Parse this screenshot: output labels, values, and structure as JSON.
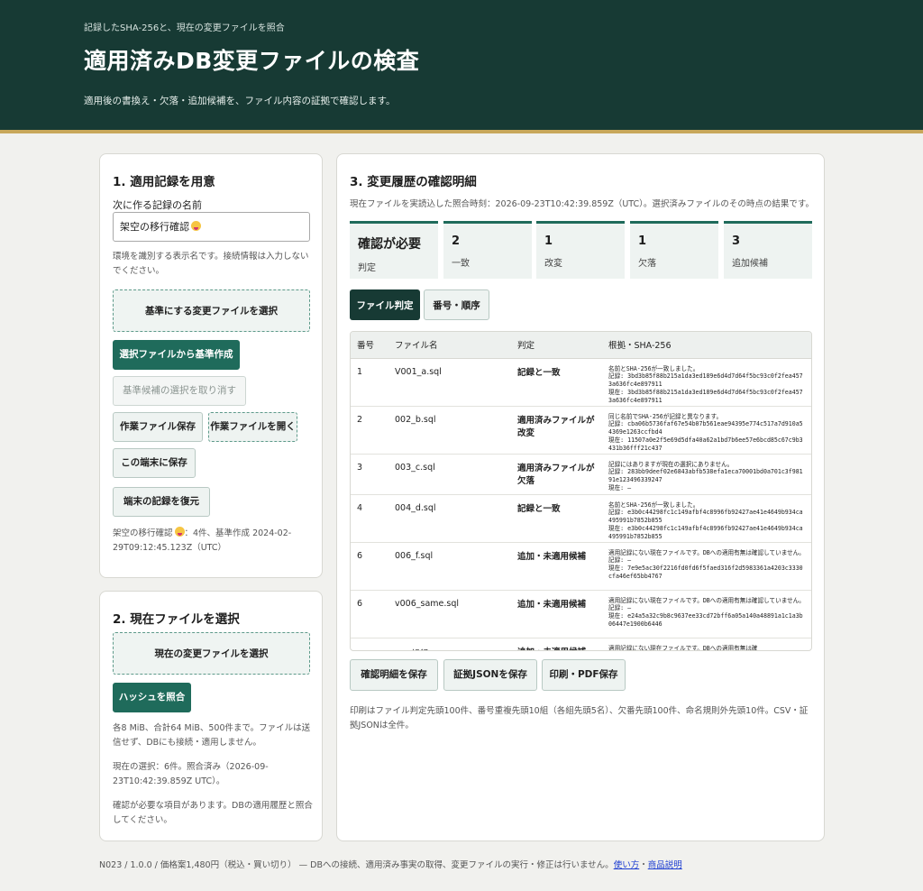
{
  "header": {
    "eyebrow": "記録したSHA-256と、現在の変更ファイルを照合",
    "title": "適用済みDB変更ファイルの検査",
    "subtitle": "適用後の書換え・欠落・追加候補を、ファイル内容の証拠で確認します。"
  },
  "step1": {
    "title": "1. 適用記録を用意",
    "name_label": "次に作る記録の名前",
    "name_value": "架空の移行確認",
    "name_hint": "環境を識別する表示名です。接続情報は入力しないでください。",
    "select_base": "基準にする変更ファイルを選択",
    "create_from_selection": "選択ファイルから基準作成",
    "cancel_candidates": "基準候補の選択を取り消す",
    "save_work_file": "作業ファイル保存",
    "open_work_file": "作業ファイルを開く",
    "save_local": "この端末に保存",
    "restore_local": "端末の記録を復元",
    "status_name": "架空の移行確認",
    "status_rest": "：4件、基準作成 2024-02-29T09:12:45.123Z（UTC）"
  },
  "step2": {
    "title": "2. 現在ファイルを選択",
    "select_current": "現在の変更ファイルを選択",
    "hash_button": "ハッシュを照合",
    "limits": "各8 MiB、合計64 MiB、500件まで。ファイルは送信せず、DBにも接続・適用しません。",
    "selection_status": "現在の選択：6件。照合済み（2026-09-23T10:42:39.859Z UTC）。",
    "warning": "確認が必要な項目があります。DBの適用履歴と照合してください。"
  },
  "step3": {
    "title": "3. 変更履歴の確認明細",
    "timestamp_note": "現在ファイルを実読込した照合時刻：2026-09-23T10:42:39.859Z（UTC）。選択済みファイルのその時点の結果です。",
    "stats": [
      {
        "value": "確認が必要",
        "label": "判定"
      },
      {
        "value": "2",
        "label": "一致"
      },
      {
        "value": "1",
        "label": "改変"
      },
      {
        "value": "1",
        "label": "欠落"
      },
      {
        "value": "3",
        "label": "追加候補"
      }
    ],
    "tabs": [
      "ファイル判定",
      "番号・順序"
    ],
    "columns": [
      "番号",
      "ファイル名",
      "判定",
      "根拠・SHA-256"
    ],
    "rows": [
      {
        "no": "1",
        "file": "V001_a.sql",
        "verdict": "記録と一致",
        "evidence": "名前とSHA-256が一致しました。\n記録: 3bd3b85f88b215a1da3ed189e6d4d7d64f5bc93c0f2fea4573a636fc4e897911\n現在: 3bd3b85f88b215a1da3ed189e6d4d7d64f5bc93c0f2fea4573a636fc4e897911"
      },
      {
        "no": "2",
        "file": "002_b.sql",
        "verdict": "適用済みファイルが改変",
        "evidence": "同じ名前でSHA-256が記録と異なります。\n記録: cba06b5736faf67e54b07b561eae94395e774c517a7d910a54369e1263ccfbd4\n現在: 11507a0e2f5e69d5dfa40a62a1bd7b6ee57e6bcd85c67c9b3431b36fff21c437"
      },
      {
        "no": "3",
        "file": "003_c.sql",
        "verdict": "適用済みファイルが欠落",
        "evidence": "記録にはありますが現在の選択にありません。\n記録: 283bb9deef02e6843abfb538efa1eca70001bd0a701c3f98191e123496339247\n現在: —"
      },
      {
        "no": "4",
        "file": "004_d.sql",
        "verdict": "記録と一致",
        "evidence": "名前とSHA-256が一致しました。\n記録: e3b0c44298fc1c149afbf4c8996fb92427ae41e4649b934ca495991b7852b855\n現在: e3b0c44298fc1c149afbf4c8996fb92427ae41e4649b934ca495991b7852b855"
      },
      {
        "no": "6",
        "file": "006_f.sql",
        "verdict": "追加・未適用候補",
        "evidence": "適用記録にない現在ファイルです。DBへの適用有無は確認していません。\n記録: —\n現在: 7e9e5ac30f2216fd0fd6f5faed316f2d5983361a4203c3330cfa46ef65bb4767"
      },
      {
        "no": "6",
        "file": "v006_same.sql",
        "verdict": "追加・未適用候補",
        "evidence": "適用記録にない現在ファイルです。DBへの適用有無は確認していません。\n記録: —\n現在: e24a5a32c9b8c9637ee33cd72bff6a05a140a48891a1c1a3b06447e1900b6446"
      },
      {
        "no": "—",
        "file": "\" = 記録.txt",
        "verdict": "追加・未適用候補",
        "evidence": "適用記録にない現在ファイルです。DBへの適用有無は確"
      }
    ],
    "save_details": "確認明細を保存",
    "save_json": "証拠JSONを保存",
    "print_pdf": "印刷・PDF保存",
    "print_note": "印刷はファイル判定先頭100件、番号重複先頭10組（各組先頭5名）、欠番先頭100件、命名規則外先頭10件。CSV・証拠JSONは全件。"
  },
  "footer": {
    "text": "N023 / 1.0.0 / 価格案1,480円（税込・買い切り） — DBへの接続、適用済み事実の取得、変更ファイルの実行・修正は行いません。",
    "link_usage": "使い方",
    "link_sep": "・",
    "link_product": "商品説明"
  }
}
